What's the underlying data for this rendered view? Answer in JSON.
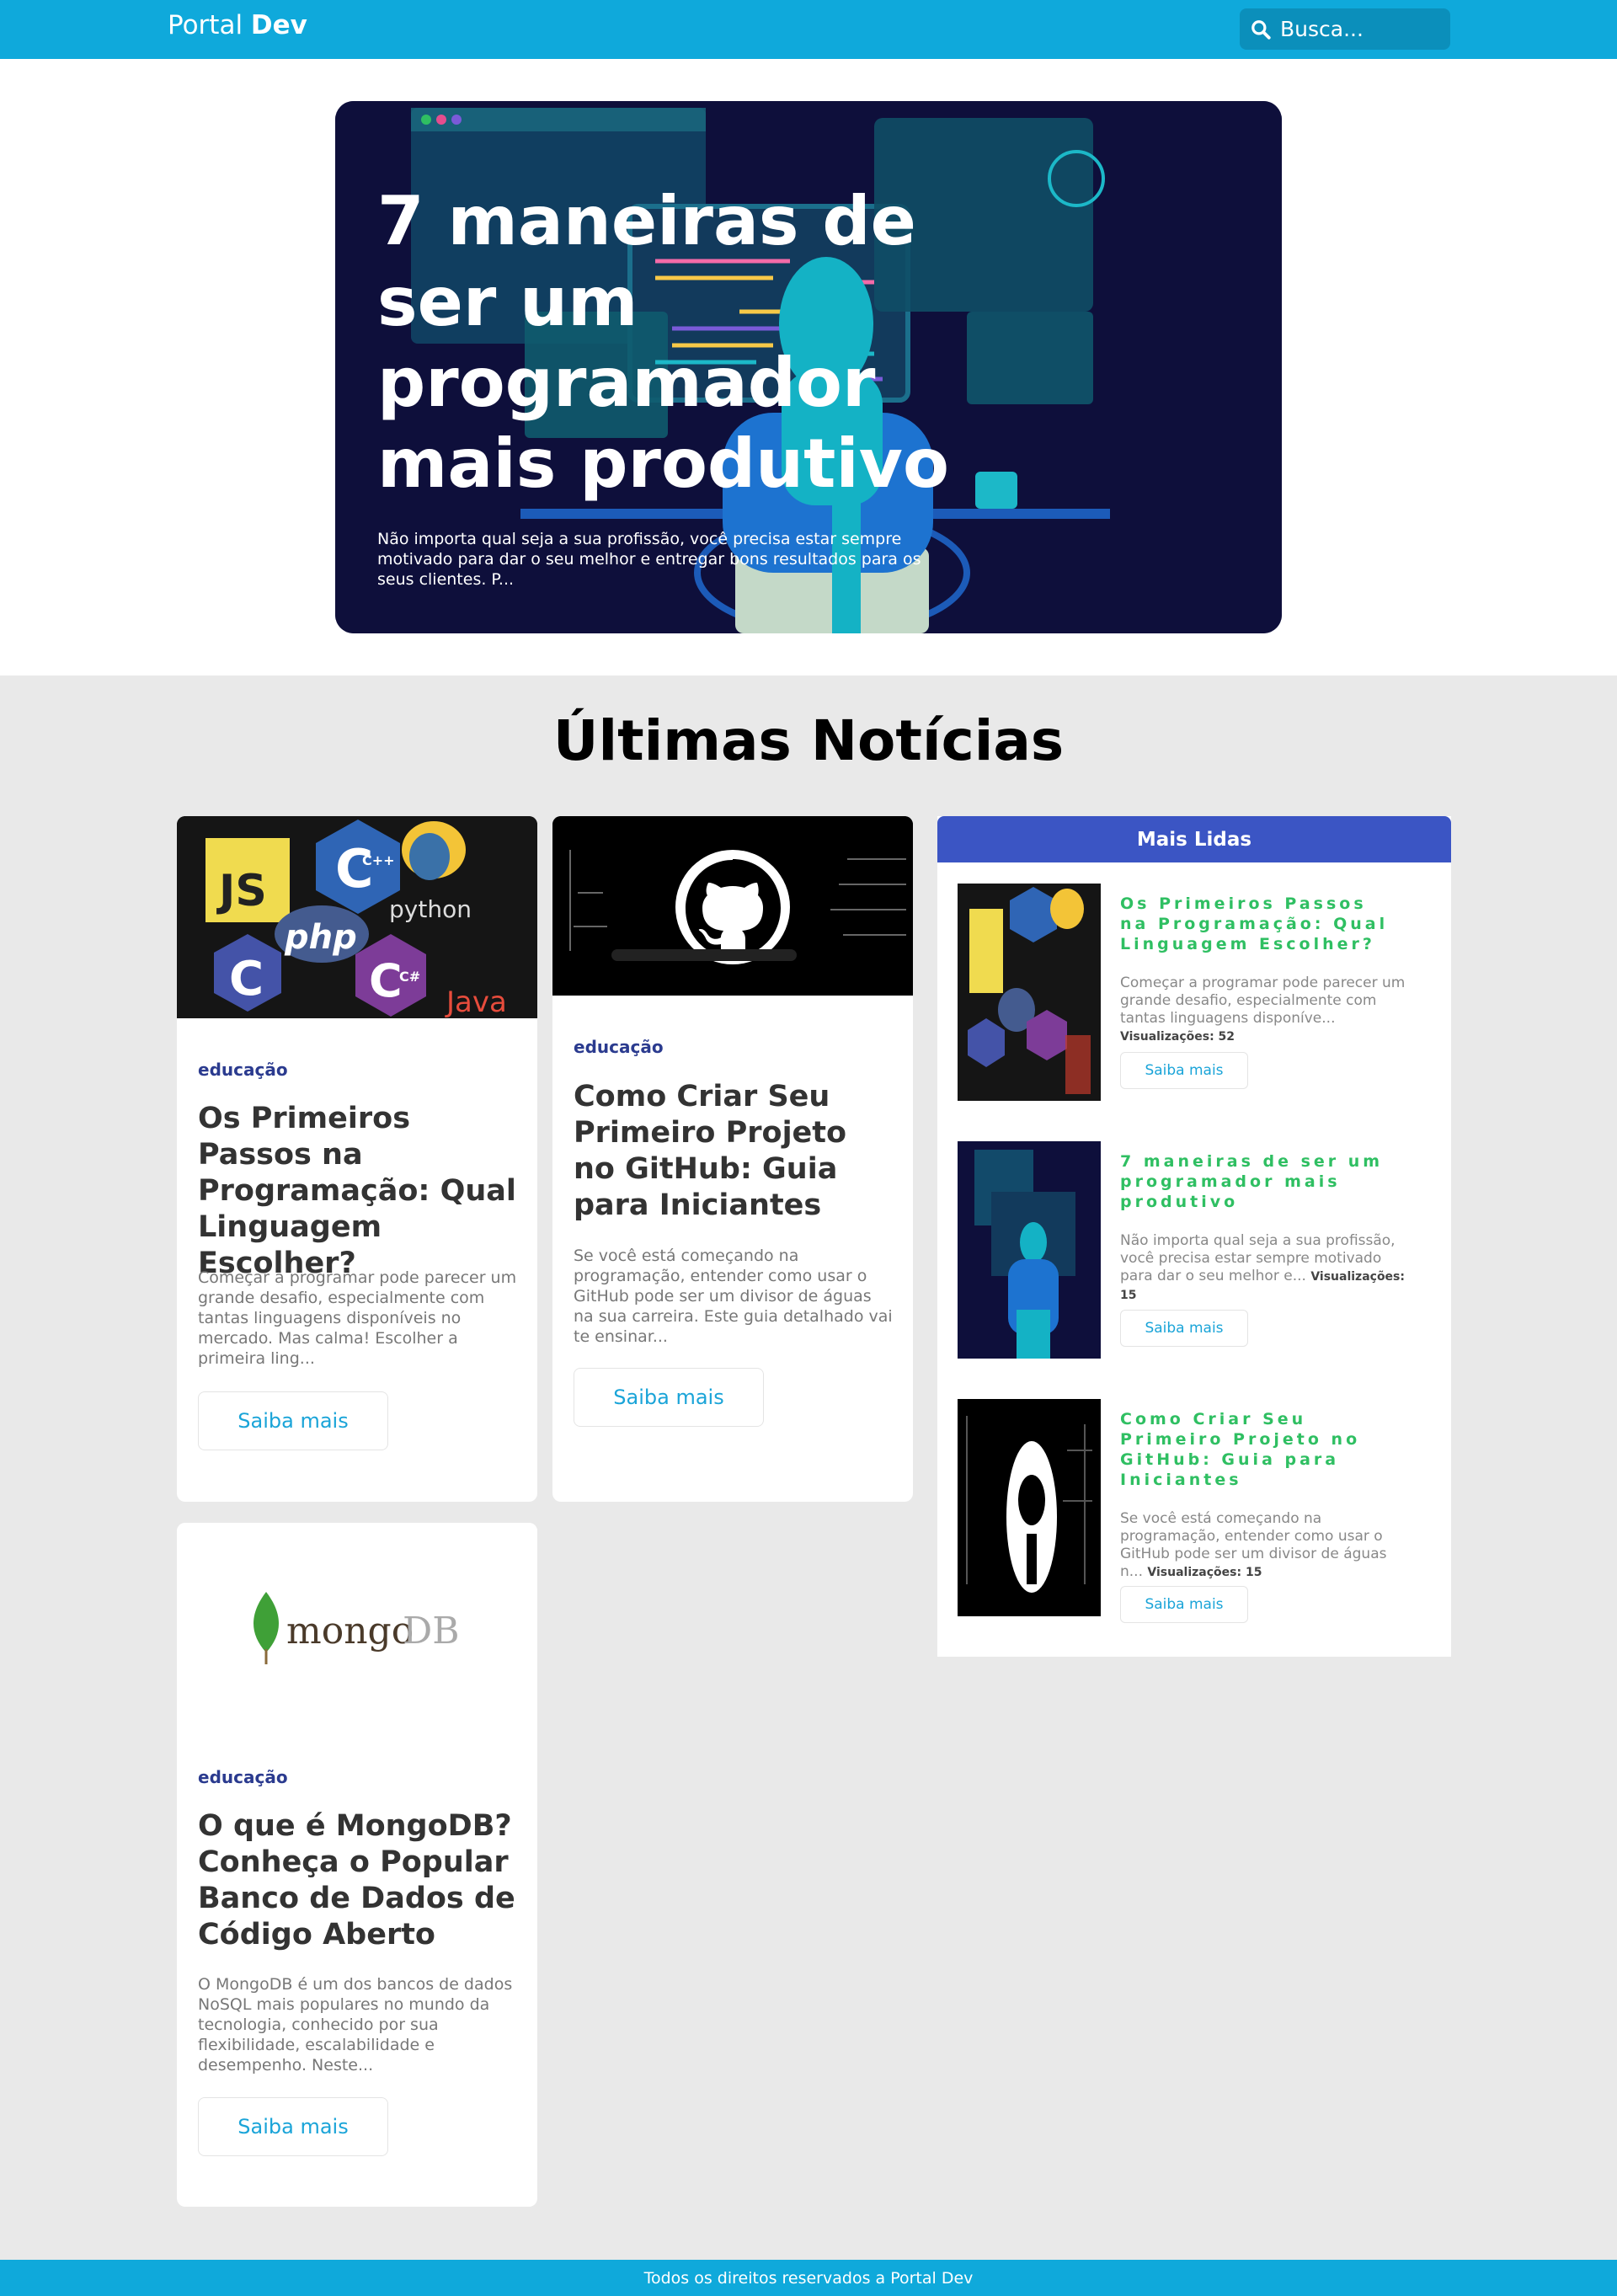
{
  "nav": {
    "brand_light": "Portal ",
    "brand_bold": "Dev",
    "search_placeholder": "Busca..."
  },
  "hero": {
    "title": "7 maneiras de ser um programador mais produtivo",
    "description": "Não importa qual seja a sua profissão, você precisa estar sempre motivado para dar o seu melhor e entregar bons resultados para os seus clientes. P..."
  },
  "section": {
    "title": "Últimas Notícias"
  },
  "cards": [
    {
      "category": "educação",
      "title": "Os Primeiros Passos na Programação: Qual Linguagem Escolher?",
      "description": "Começar a programar pode parecer um grande desafio, especialmente com tantas linguagens disponíveis no mercado. Mas calma! Escolher a primeira ling...",
      "button": "Saiba mais",
      "thumb_labels": [
        "JS",
        "php",
        "python",
        "Java",
        "C",
        "C++",
        "C#"
      ]
    },
    {
      "category": "educação",
      "title": "Como Criar Seu Primeiro Projeto no GitHub: Guia para Iniciantes",
      "description": "Se você está começando na programação, entender como usar o GitHub pode ser um divisor de águas na sua carreira. Este guia detalhado vai te ensinar...",
      "button": "Saiba mais"
    },
    {
      "category": "educação",
      "title": "O que é MongoDB? Conheça o Popular Banco de Dados de Código Aberto",
      "description": "O MongoDB é um dos bancos de dados NoSQL mais populares no mundo da tecnologia, conhecido por sua flexibilidade, escalabilidade e desempenho. Neste...",
      "button": "Saiba mais",
      "logo_text_1": "mongo",
      "logo_text_2": "DB"
    }
  ],
  "sidebar": {
    "title": "Mais Lidas",
    "items": [
      {
        "title": "Os Primeiros Passos na Programação: Qual Linguagem Escolher?",
        "description": "Começar a programar pode parecer um grande desafio, especialmente com tantas linguagens disponíve...",
        "views_label": "Visualizações: 52",
        "button": "Saiba mais"
      },
      {
        "title": "7 maneiras de ser um programador mais produtivo",
        "description": "Não importa qual seja a sua profissão, você precisa estar sempre motivado para dar o seu melhor e...",
        "views_label": "Visualizações: 15",
        "button": "Saiba mais"
      },
      {
        "title": "Como Criar Seu Primeiro Projeto no GitHub: Guia para Iniciantes",
        "description": "Se você está começando na programação, entender como usar o GitHub pode ser um divisor de águas n...",
        "views_label": "Visualizações: 15",
        "button": "Saiba mais"
      }
    ]
  },
  "footer": {
    "text": "Todos os direitos reservados a Portal Dev"
  },
  "colors": {
    "primary": "#0fa9db",
    "sidebar_header": "#3b55c4",
    "sidebar_title": "#2fbf62",
    "category": "#2b3b8f",
    "hero_bg": "#0e0f3b"
  }
}
